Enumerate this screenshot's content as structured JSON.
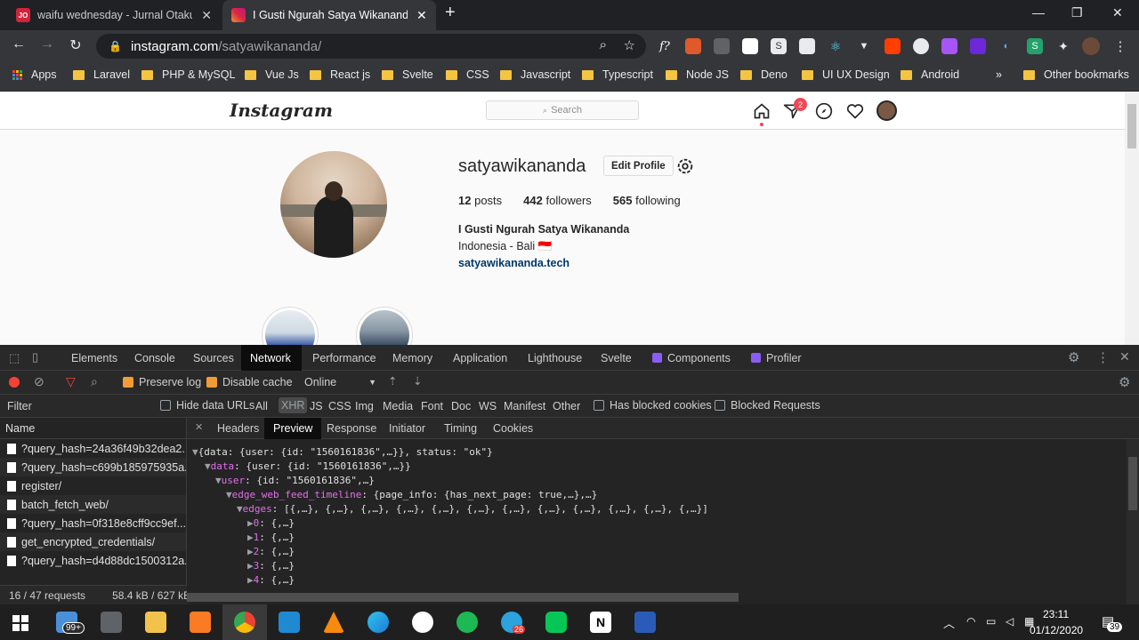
{
  "browser": {
    "tabs": [
      {
        "title": "waifu wednesday - Jurnal Otaku Indonesia",
        "favicon_color": "#d1243a",
        "favicon_text": "JO",
        "active": false
      },
      {
        "title": "I Gusti Ngurah Satya Wikananda",
        "favicon_color": "#c13584",
        "favicon_text": "",
        "active": true
      }
    ],
    "new_tab": "+",
    "close": "✕",
    "url_host": "instagram.com",
    "url_path": "/satyawikananda/",
    "bookmarks": [
      "Apps",
      "Laravel",
      "PHP & MySQL",
      "Vue Js",
      "React js",
      "Svelte",
      "CSS",
      "Javascript",
      "Typescript",
      "Node JS",
      "Deno",
      "UI UX Design",
      "Android"
    ],
    "more": "»",
    "other_bookmarks": "Other bookmarks"
  },
  "instagram": {
    "logo": "Instagram",
    "search_placeholder": "Search",
    "notification_count": "2",
    "username": "satyawikananda",
    "edit_profile": "Edit Profile",
    "stats": {
      "posts_num": "12",
      "posts_label": "posts",
      "followers_num": "442",
      "followers_label": "followers",
      "following_num": "565",
      "following_label": "following"
    },
    "full_name": "I Gusti Ngurah Satya Wikananda",
    "location": "Indonesia - Bali 🇮🇩",
    "website": "satyawikananda.tech"
  },
  "devtools": {
    "tabs": [
      "Elements",
      "Console",
      "Sources",
      "Network",
      "Performance",
      "Memory",
      "Application",
      "Lighthouse",
      "Svelte",
      "Components",
      "Profiler"
    ],
    "active_tab": "Network",
    "toolbar": {
      "preserve_log": "Preserve log",
      "disable_cache": "Disable cache",
      "throttle": "Online"
    },
    "filter": {
      "placeholder": "Filter",
      "hide_data_urls": "Hide data URLs",
      "types": [
        "All",
        "XHR",
        "JS",
        "CSS",
        "Img",
        "Media",
        "Font",
        "Doc",
        "WS",
        "Manifest",
        "Other"
      ],
      "active_type": "XHR",
      "has_blocked": "Has blocked cookies",
      "blocked_requests": "Blocked Requests"
    },
    "name_header": "Name",
    "requests": [
      "?query_hash=24a36f49b32dea2...",
      "?query_hash=c699b185975935a...",
      "register/",
      "batch_fetch_web/",
      "?query_hash=0f318e8cff9cc9ef...",
      "get_encrypted_credentials/",
      "?query_hash=d4d88dc1500312a..."
    ],
    "footer": {
      "requests": "16 / 47 requests",
      "size": "58.4 kB / 627 kB t"
    },
    "detail_tabs": [
      "Headers",
      "Preview",
      "Response",
      "Initiator",
      "Timing",
      "Cookies"
    ],
    "active_detail": "Preview",
    "preview": {
      "line1": "{data: {user: {id: \"1560161836\",…}}, status: \"ok\"}",
      "line2_key": "data",
      "line2_val": ": {user: {id: \"1560161836\",…}}",
      "line3_key": "user",
      "line3_val": ": {id: \"1560161836\",…}",
      "line4_key": "edge_web_feed_timeline",
      "line4_val": ": {page_info: {has_next_page: true,…},…}",
      "line5_key": "edges",
      "line5_val": ": [{,…}, {,…}, {,…}, {,…}, {,…}, {,…}, {,…}, {,…}, {,…}, {,…}, {,…}, {,…}]",
      "items": [
        "0",
        "1",
        "2",
        "3",
        "4"
      ],
      "item_val": ": {,…}"
    }
  },
  "taskbar": {
    "badge_count": "99+",
    "telegram_badge": "26",
    "time": "23:11",
    "date": "01/12/2020",
    "notif_count": "39"
  }
}
